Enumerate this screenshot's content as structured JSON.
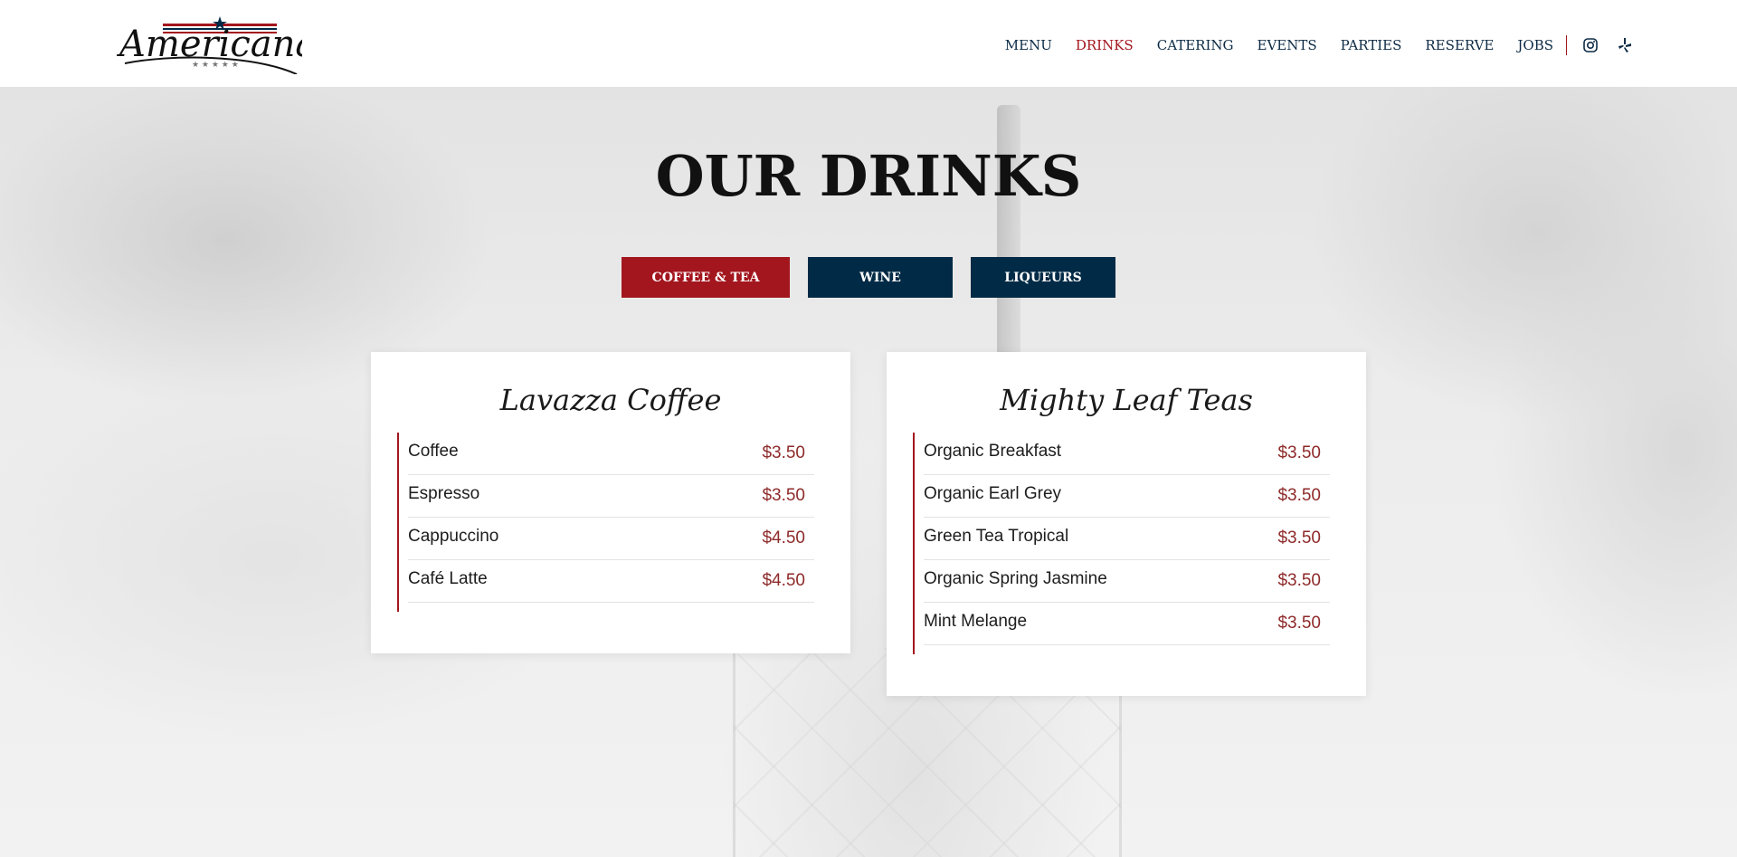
{
  "brand": {
    "logo_text": "Americana",
    "colors": {
      "navy": "#002a45",
      "red": "#a3161e",
      "price": "#8e2a2a"
    }
  },
  "nav": {
    "items": [
      {
        "label": "MENU",
        "active": false
      },
      {
        "label": "DRINKS",
        "active": true
      },
      {
        "label": "CATERING",
        "active": false
      },
      {
        "label": "EVENTS",
        "active": false
      },
      {
        "label": "PARTIES",
        "active": false
      },
      {
        "label": "RESERVE",
        "active": false
      },
      {
        "label": "JOBS",
        "active": false
      }
    ],
    "icons": [
      "instagram-icon",
      "yelp-icon"
    ]
  },
  "page": {
    "title": "OUR DRINKS",
    "tabs": [
      {
        "label": "COFFEE & TEA",
        "active": true
      },
      {
        "label": "WINE",
        "active": false
      },
      {
        "label": "LIQUEURS",
        "active": false
      }
    ]
  },
  "cards": [
    {
      "title": "Lavazza Coffee",
      "items": [
        {
          "name": "Coffee",
          "price": "$3.50"
        },
        {
          "name": "Espresso",
          "price": "$3.50"
        },
        {
          "name": "Cappuccino",
          "price": "$4.50"
        },
        {
          "name": "Café Latte",
          "price": "$4.50"
        }
      ]
    },
    {
      "title": "Mighty Leaf Teas",
      "items": [
        {
          "name": "Organic Breakfast",
          "price": "$3.50"
        },
        {
          "name": "Organic Earl Grey",
          "price": "$3.50"
        },
        {
          "name": "Green Tea Tropical",
          "price": "$3.50"
        },
        {
          "name": "Organic Spring Jasmine",
          "price": "$3.50"
        },
        {
          "name": "Mint Melange",
          "price": "$3.50"
        }
      ]
    }
  ]
}
